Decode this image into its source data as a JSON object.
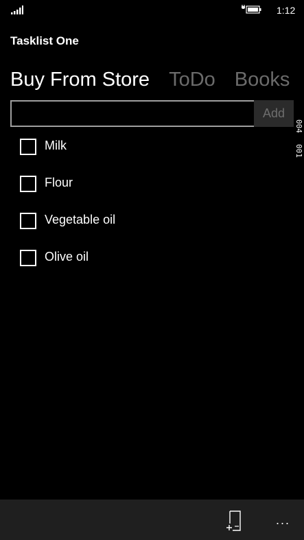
{
  "status_bar": {
    "time": "1:12",
    "signal_icon": "signal-bars-icon",
    "battery_icon": "battery-charging-icon"
  },
  "app": {
    "title": "Tasklist One"
  },
  "pivot": {
    "tabs": [
      {
        "label": "Buy From Store",
        "active": true
      },
      {
        "label": "ToDo",
        "active": false
      },
      {
        "label": "Books",
        "active": false
      }
    ]
  },
  "input": {
    "value": "",
    "placeholder": "",
    "add_label": "Add"
  },
  "debug_numbers": [
    "004",
    "001"
  ],
  "tasks": [
    {
      "label": "Milk",
      "checked": false
    },
    {
      "label": "Flour",
      "checked": false
    },
    {
      "label": "Vegetable oil",
      "checked": false
    },
    {
      "label": "Olive oil",
      "checked": false
    }
  ],
  "app_bar": {
    "new_list_icon": "new-list-icon",
    "more_label": "..."
  },
  "colors": {
    "background": "#000000",
    "inactive_tab": "#6b6b6b",
    "app_bar": "#1f1f1f",
    "add_button_bg": "#2b2b2b"
  }
}
